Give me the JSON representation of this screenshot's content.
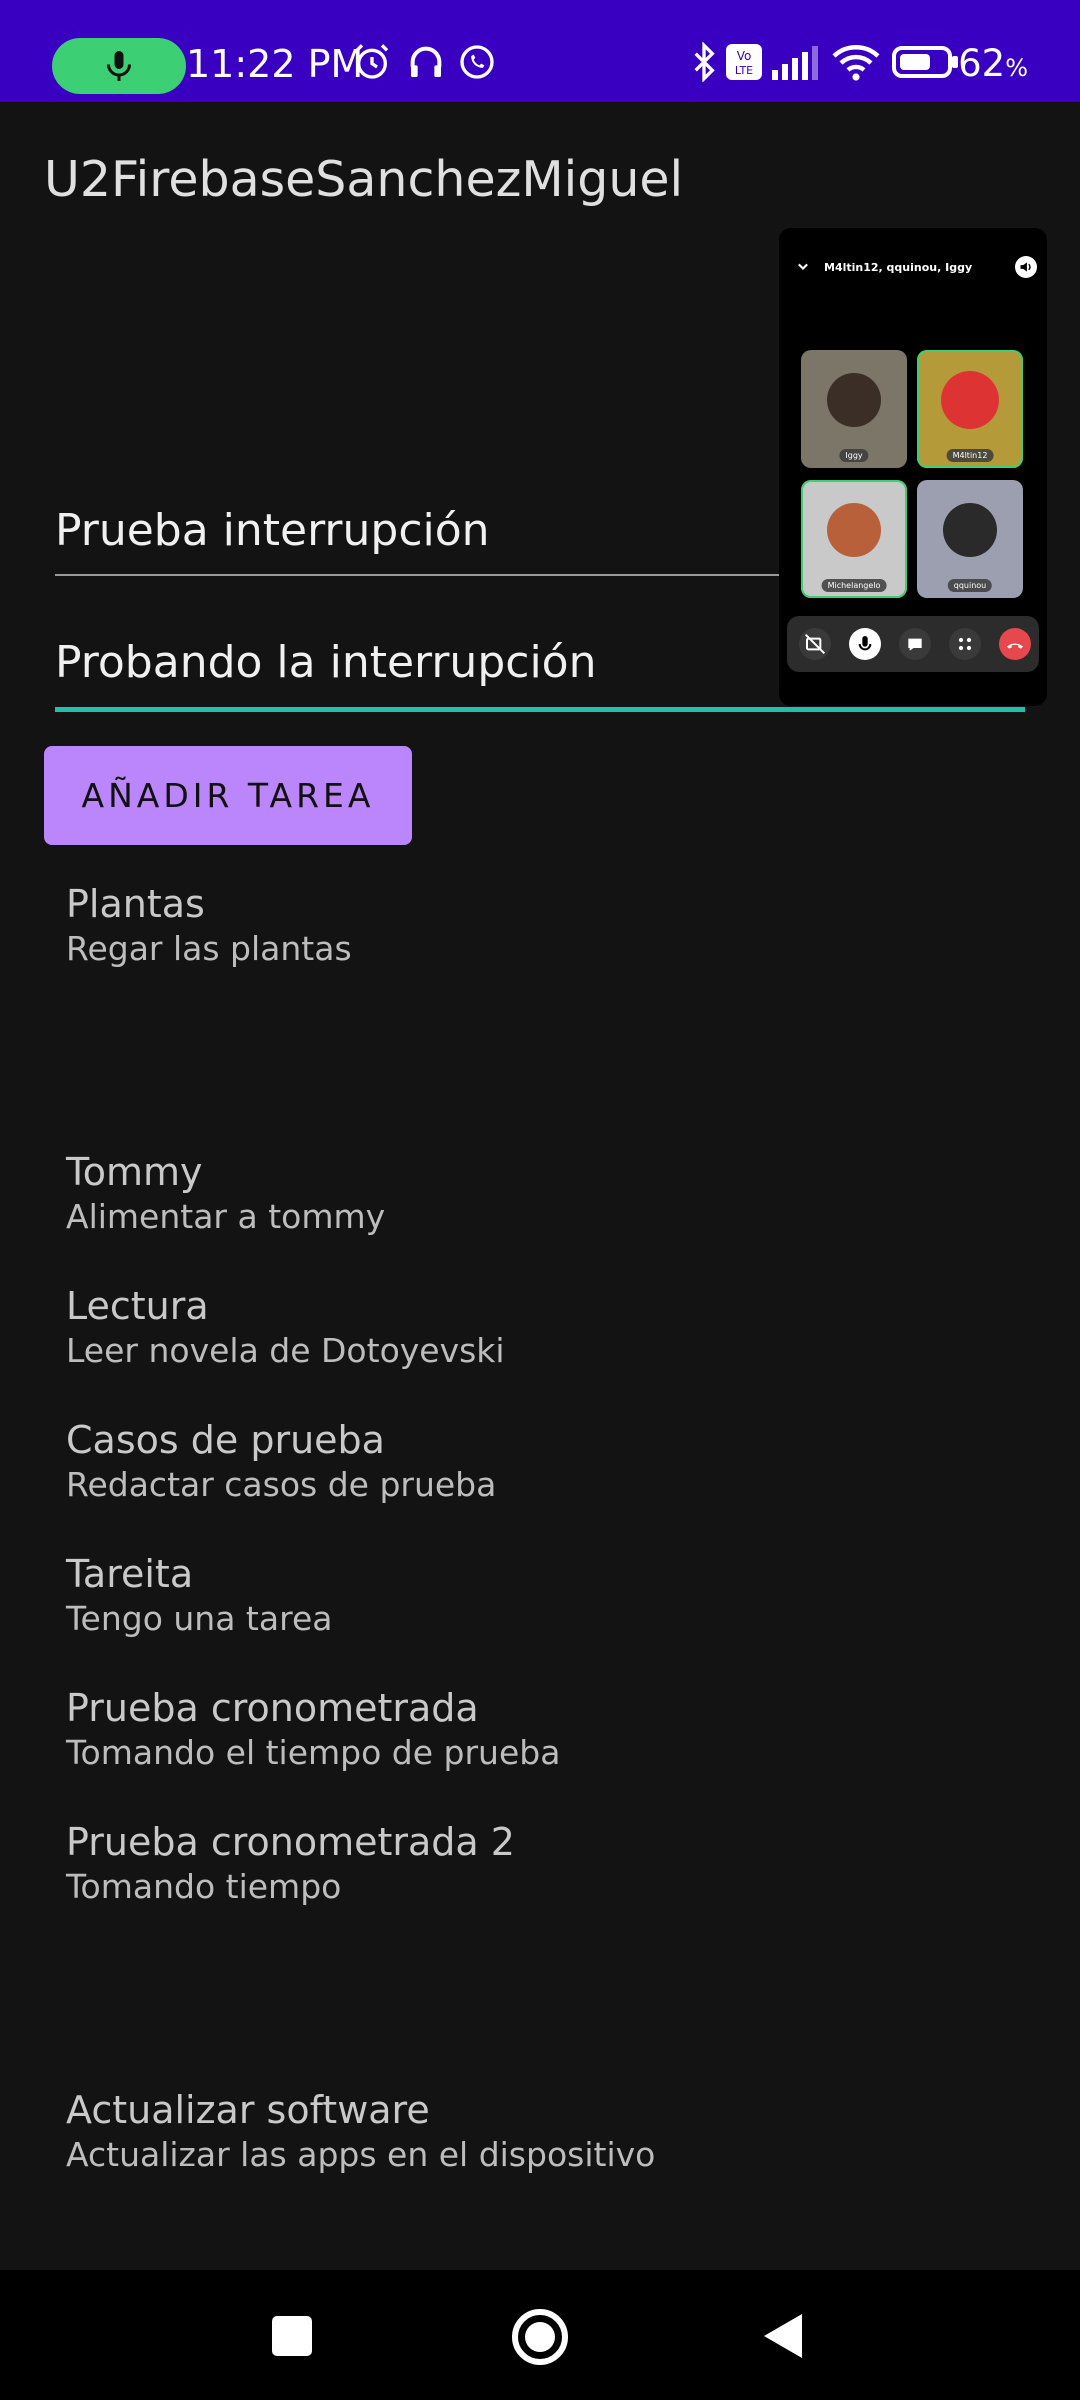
{
  "status_bar": {
    "time": "11:22 PM",
    "battery_percent": "62",
    "battery_unit": "%",
    "icons": [
      "mic-icon",
      "alarm-icon",
      "headphones-icon",
      "whatsapp-icon",
      "bluetooth-icon",
      "volte-icon",
      "signal-icon",
      "wifi-icon",
      "battery-icon"
    ]
  },
  "app": {
    "title": "U2FirebaseSanchezMiguel"
  },
  "form": {
    "title_value": "Prueba interrupción",
    "description_value": "Probando la interrupción",
    "add_button_label": "AÑADIR TAREA"
  },
  "tasks": [
    {
      "title": "Plantas",
      "description": "Regar las plantas"
    },
    {
      "title": "Tommy",
      "description": "Alimentar a tommy"
    },
    {
      "title": "Lectura",
      "description": "Leer novela de Dotoyevski"
    },
    {
      "title": "Casos de prueba",
      "description": "Redactar casos de prueba"
    },
    {
      "title": "Tareita",
      "description": "Tengo una tarea"
    },
    {
      "title": "Prueba cronometrada",
      "description": "Tomando el tiempo de prueba"
    },
    {
      "title": "Prueba cronometrada 2",
      "description": "Tomando tiempo"
    },
    {
      "title": "Actualizar software",
      "description": "Actualizar las apps en el dispositivo"
    }
  ],
  "pip_call": {
    "participants_header": "M4ltin12, qquinou, Iggy",
    "tiles": [
      "Iggy",
      "M4ltin12",
      "Michelangelo",
      "qquinou"
    ],
    "colors": {
      "tile1": "#7b7668",
      "tile2": "#b59a3a",
      "tile3": "#c9c9c9",
      "tile4": "#9b9fb0",
      "end_call": "#e5484d"
    }
  },
  "colors": {
    "status_bar": "#3a00c2",
    "accent_button": "#bb86fc",
    "focus_underline": "#1fc2a8",
    "background": "#131313"
  }
}
